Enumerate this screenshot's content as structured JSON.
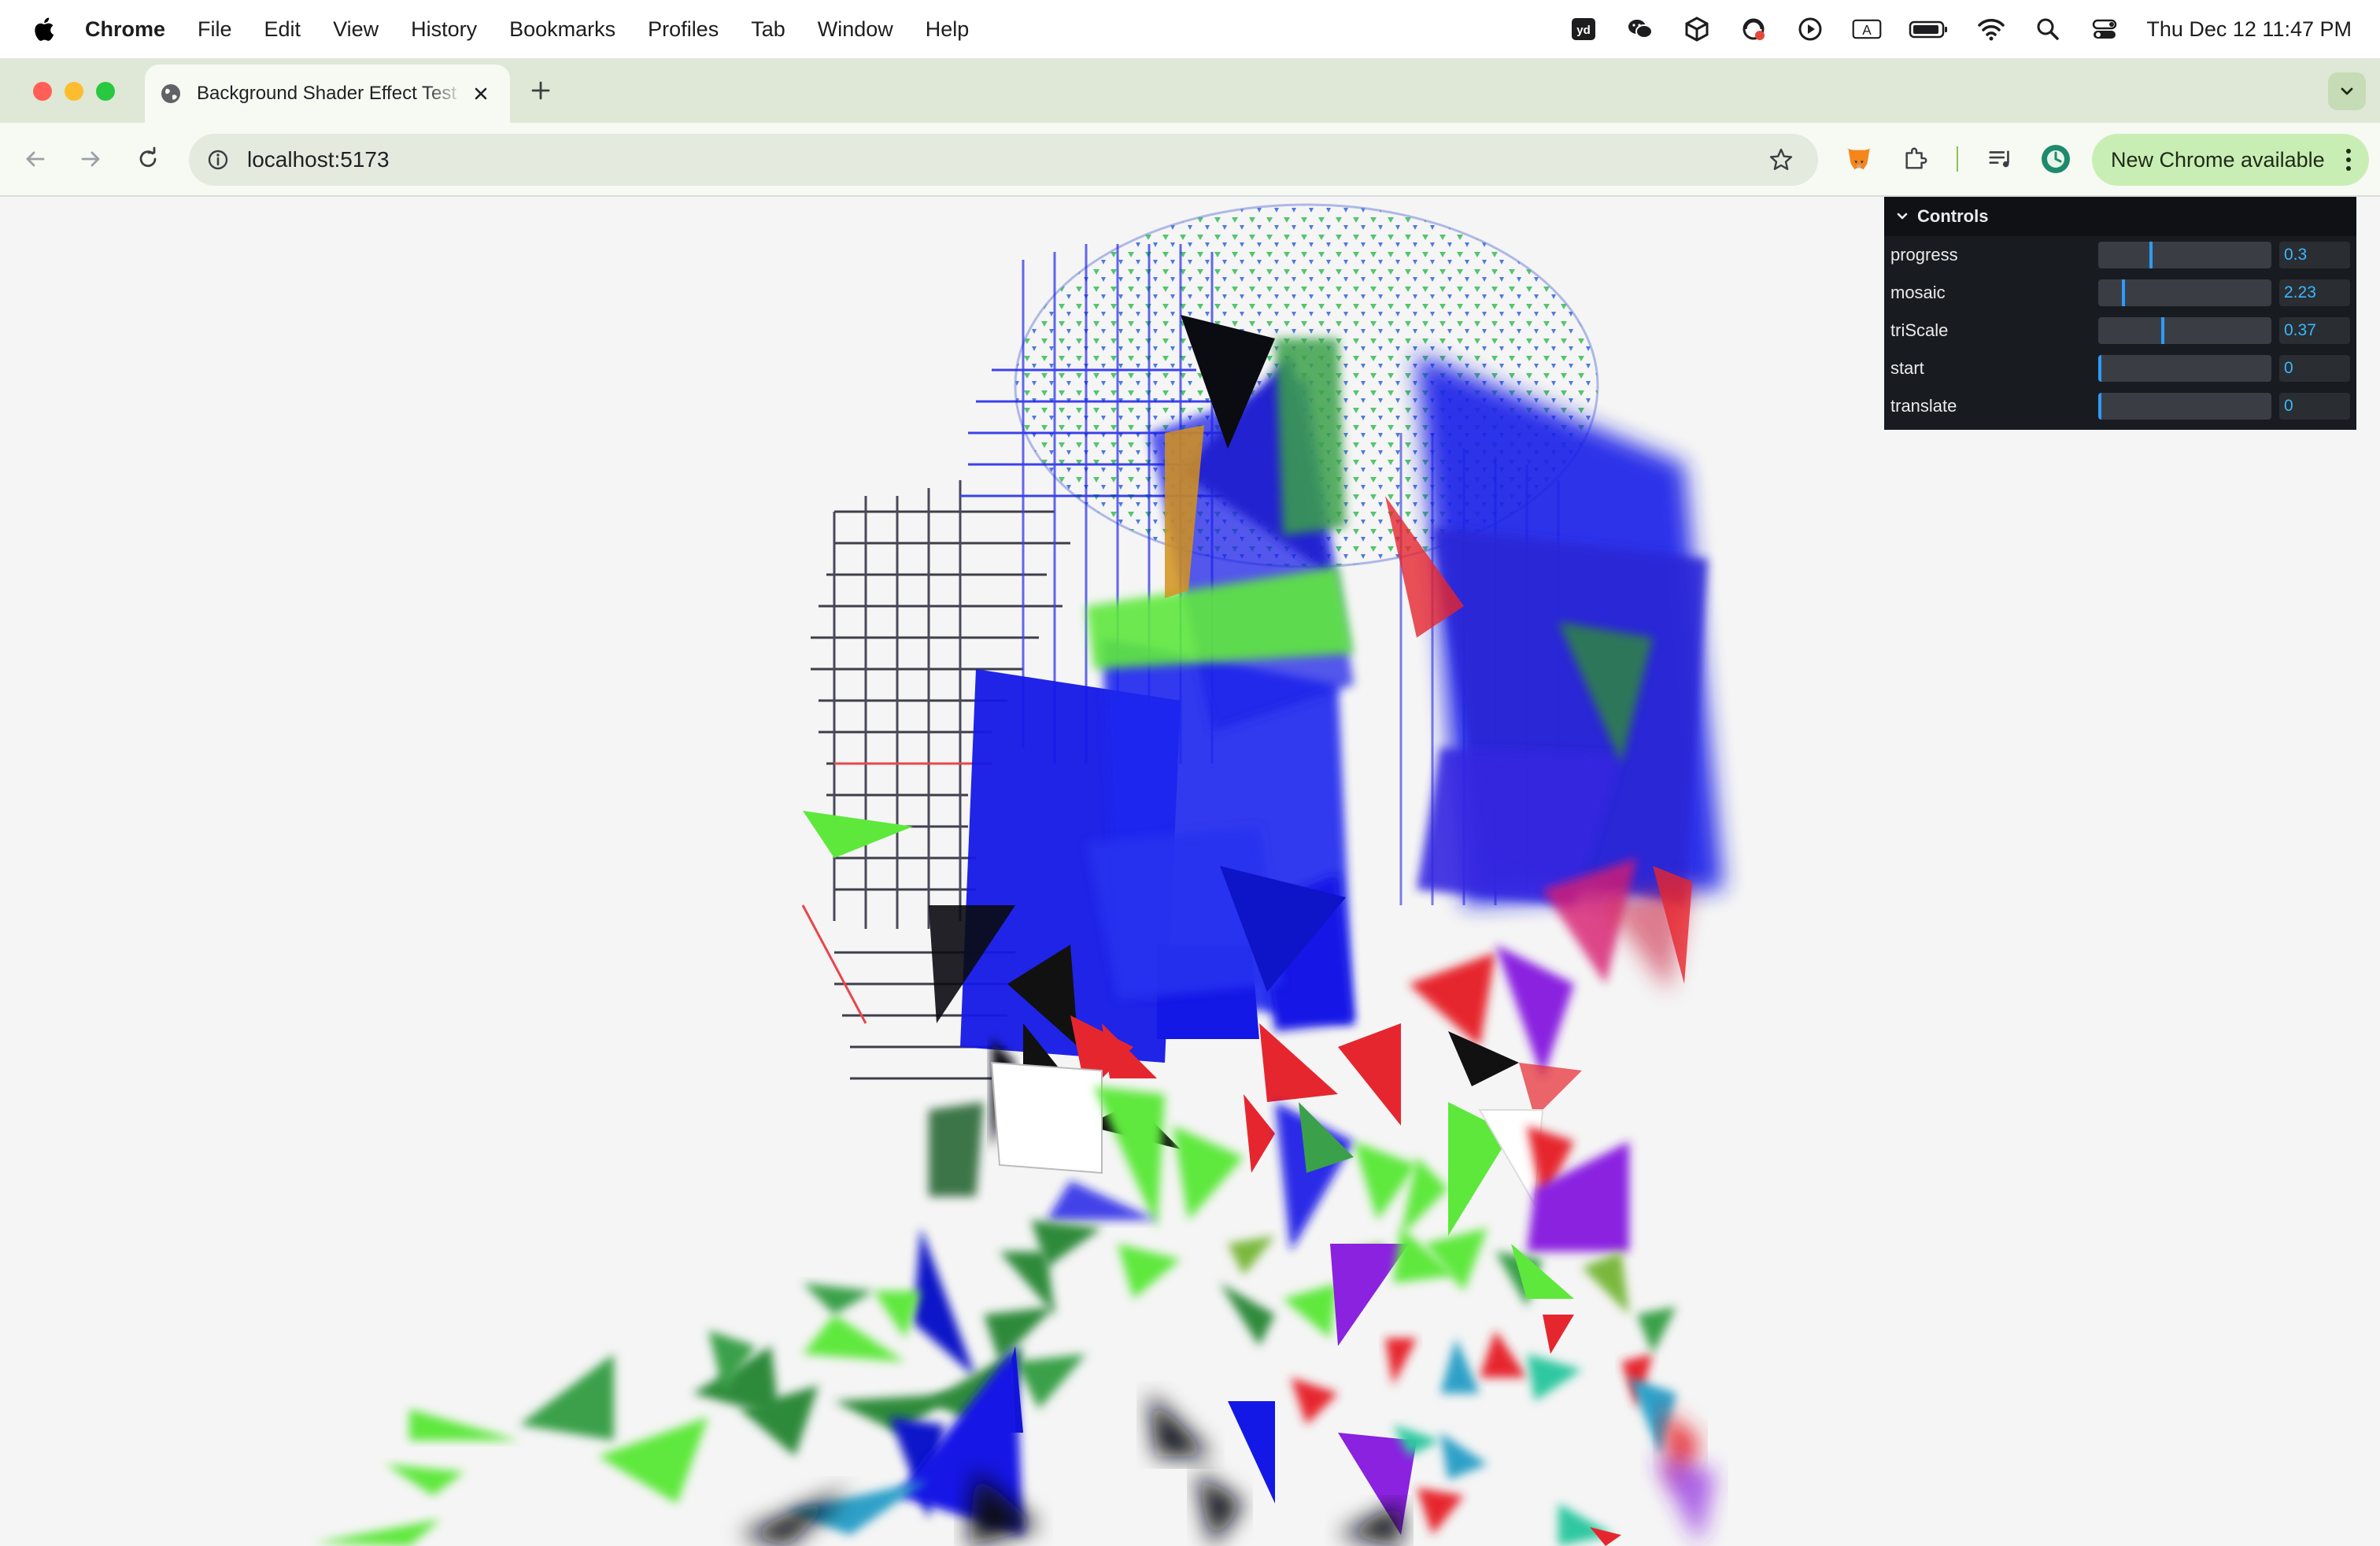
{
  "menubar": {
    "app_name": "Chrome",
    "items": [
      "File",
      "Edit",
      "View",
      "History",
      "Bookmarks",
      "Profiles",
      "Tab",
      "Window",
      "Help"
    ],
    "clock": "Thu Dec 12  11:47 PM"
  },
  "tab": {
    "title": "Background Shader Effect Test"
  },
  "address_bar": {
    "url": "localhost:5173"
  },
  "update_button": {
    "label": "New Chrome available"
  },
  "controls": {
    "title": "Controls",
    "rows": [
      {
        "name": "progress",
        "value": "0.3",
        "fraction": 0.3
      },
      {
        "name": "mosaic",
        "value": "2.23",
        "fraction": 0.14
      },
      {
        "name": "triScale",
        "value": "0.37",
        "fraction": 0.37
      },
      {
        "name": "start",
        "value": "0",
        "fraction": 0
      },
      {
        "name": "translate",
        "value": "0",
        "fraction": 0
      }
    ]
  },
  "colors": {
    "accent_green": "#c9eeb5",
    "panel_bg": "#181c20",
    "value_text": "#39b6ff",
    "shader_blue": "#1a22e8",
    "shader_green": "#5ee83c",
    "shader_red": "#e6262e",
    "shader_purple": "#8a22e0"
  }
}
